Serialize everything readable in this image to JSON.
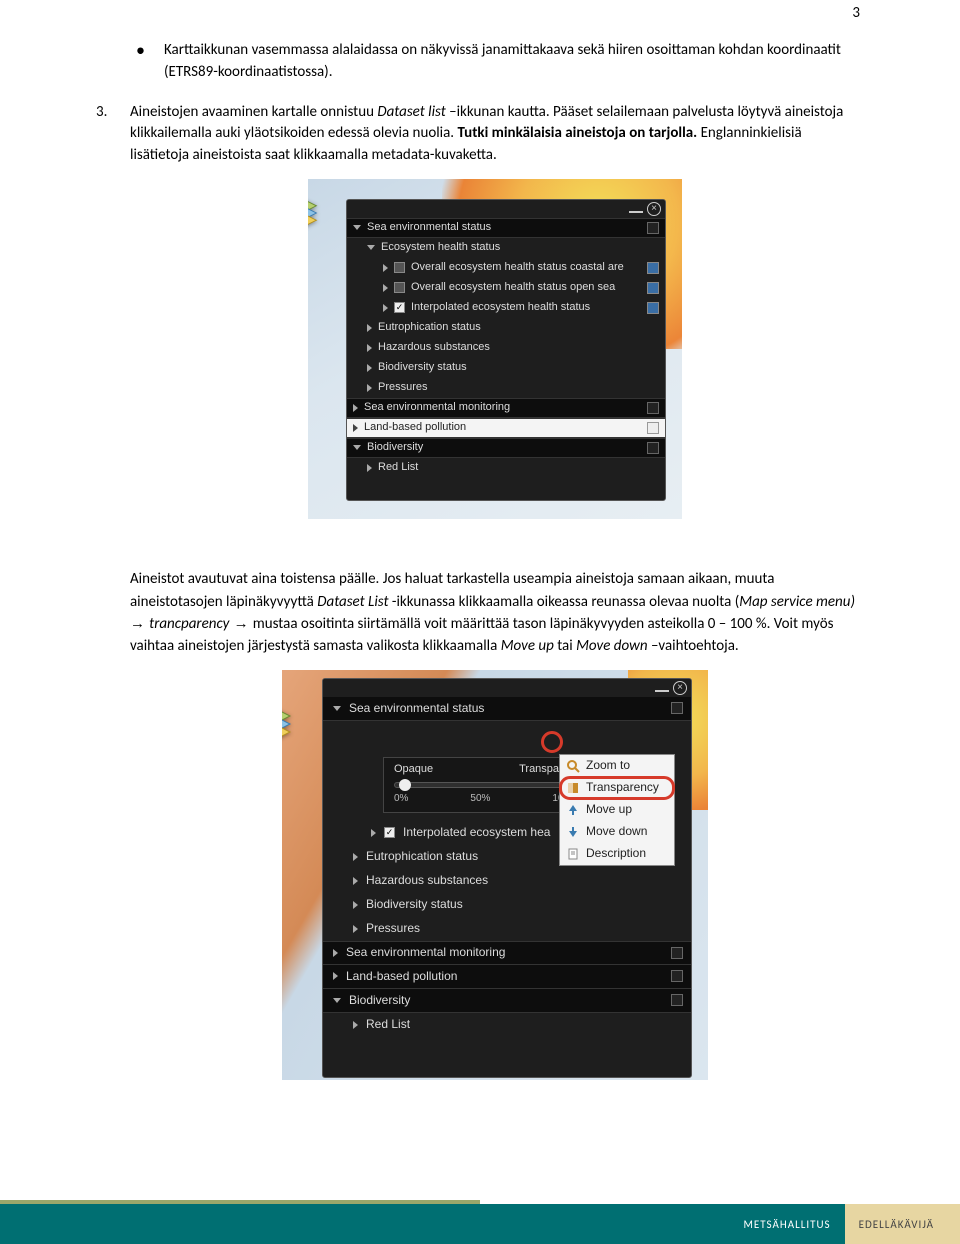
{
  "page_number": "3",
  "bullet_text": "Karttaikkunan vasemmassa alalaidassa on näkyvissä janamittakaava sekä hiiren osoittaman kohdan koordinaatit (ETRS89-koordinaatistossa).",
  "item3": {
    "num": "3.",
    "p1a": "Aineistojen avaaminen kartalle onnistuu ",
    "p1b": "Dataset list",
    "p1c": " –ikkunan kautta. Pääset selailemaan palvelusta löytyvä aineistoja klikkailemalla auki yläotsikoiden edessä olevia nuolia. ",
    "p1d": "Tutki minkälaisia aineistoja on tarjolla.",
    "p1e": " Englanninkielisiä lisätietoja aineistoista saat klikkaamalla metadata-kuvaketta."
  },
  "panel1": {
    "cat1": "Sea environmental status",
    "sub1": "Ecosystem health status",
    "leaf1": "Overall ecosystem health status coastal are",
    "leaf2": "Overall ecosystem health status open sea",
    "leaf3": "Interpolated ecosystem health status",
    "sub2": "Eutrophication status",
    "sub3": "Hazardous substances",
    "sub4": "Biodiversity status",
    "sub5": "Pressures",
    "cat2": "Sea environmental monitoring",
    "cat3": "Land-based pollution",
    "cat4": "Biodiversity",
    "sub6": "Red List"
  },
  "para2": {
    "a": "Aineistot avautuvat aina toistensa päälle. Jos haluat tarkastella useampia aineistoja samaan aikaan, muuta aineistotasojen läpinäkyvyyttä ",
    "b": "Dataset List",
    "c": " -ikkunassa klikkaamalla oikeassa reunassa olevaa nuolta (",
    "d": "Map service menu)",
    "e": "trancparency",
    "f": " mustaa osoitinta siirtämällä voit määrittää tason läpinäkyvyyden asteikolla 0 – 100 %. Voit myös vaihtaa aineistojen järjestystä samasta valikosta klikkaamalla ",
    "g": "Move up",
    "h": " tai ",
    "i": "Move down",
    "j": " –vaihtoehtoja."
  },
  "panel2": {
    "cat1": "Sea environmental status",
    "leaf3": "Interpolated ecosystem hea",
    "sub2": "Eutrophication status",
    "sub3": "Hazardous substances",
    "sub4": "Biodiversity status",
    "sub5": "Pressures",
    "cat2": "Sea environmental monitoring",
    "cat3": "Land-based pollution",
    "cat4": "Biodiversity",
    "sub6": "Red List"
  },
  "ctxmenu": {
    "zoom": "Zoom to",
    "transparency": "Transparency",
    "moveup": "Move up",
    "movedown": "Move down",
    "description": "Description"
  },
  "slider": {
    "opaque": "Opaque",
    "transparent": "Transparent",
    "t0": "0%",
    "t50": "50%",
    "t100": "100%"
  },
  "footer": {
    "brand": "METSÄHALLITUS",
    "tag": "EDELLÄKÄVIJÄ"
  }
}
